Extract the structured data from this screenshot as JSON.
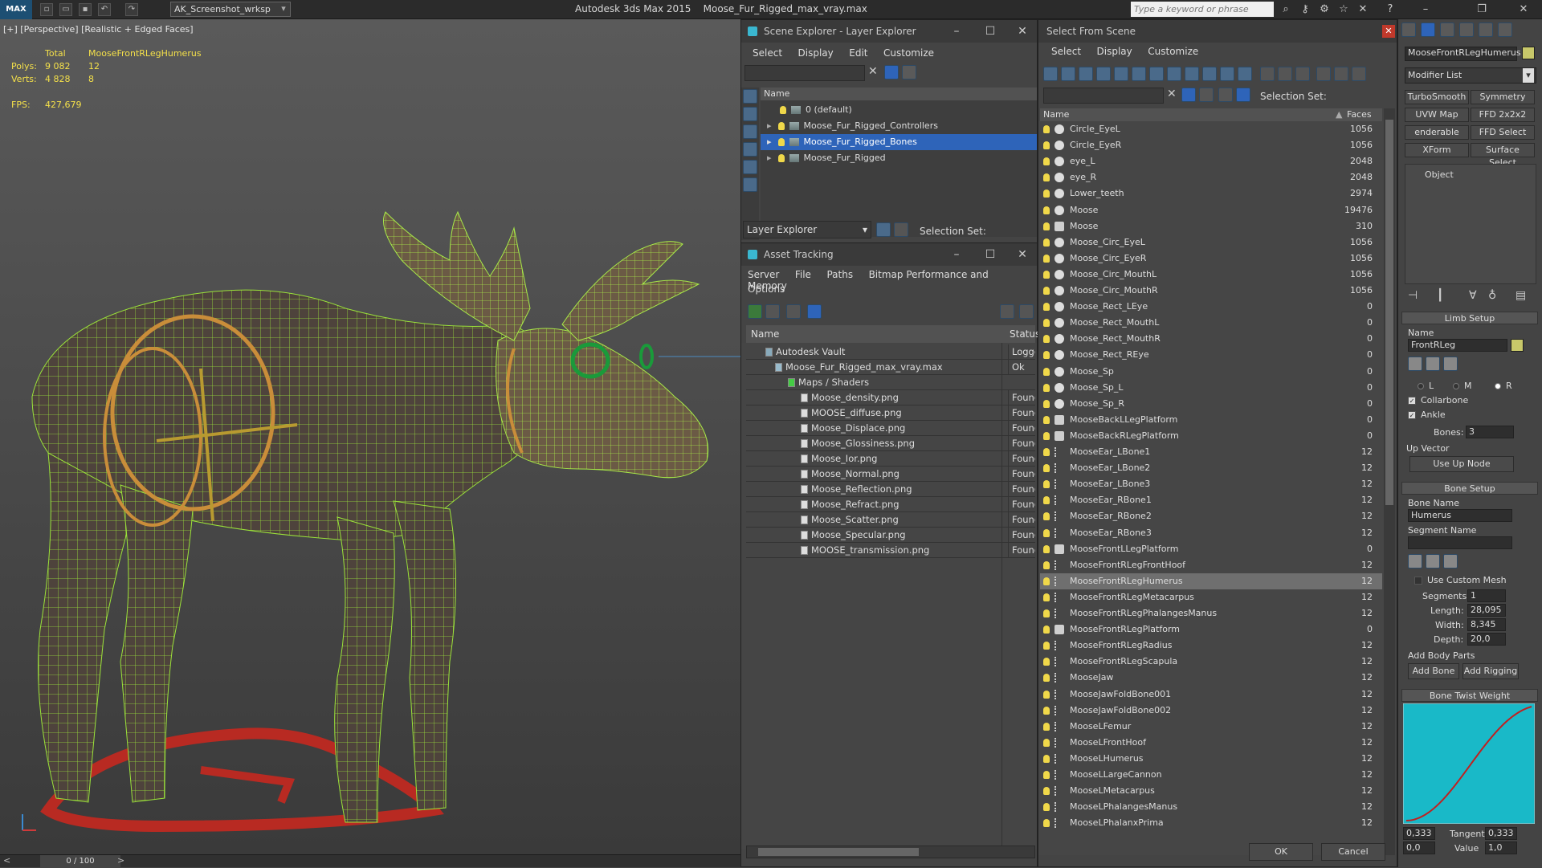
{
  "app": {
    "logo": "MAX",
    "workspace": "AK_Screenshot_wrksp",
    "title": "Autodesk 3ds Max  2015",
    "filename": "Moose_Fur_Rigged_max_vray.max",
    "search_placeholder": "Type a keyword or phrase"
  },
  "viewport": {
    "label": "[+] [Perspective] [Realistic + Edged Faces]",
    "stats": {
      "total_label": "Total",
      "object_name": "MooseFrontRLegHumerus",
      "polys_label": "Polys:",
      "polys_total": "9 082",
      "polys_obj": "12",
      "verts_label": "Verts:",
      "verts_total": "4 828",
      "verts_obj": "8",
      "fps_label": "FPS:",
      "fps_value": "427,679"
    }
  },
  "timeline": {
    "frame": "0 / 100",
    "prev": "<",
    "next": ">"
  },
  "scene_explorer": {
    "title": "Scene Explorer - Layer Explorer",
    "menus": [
      "Select",
      "Display",
      "Edit",
      "Customize"
    ],
    "column": "Name",
    "layers": [
      {
        "name": "0 (default)",
        "selected": false,
        "expandable": false
      },
      {
        "name": "Moose_Fur_Rigged_Controllers",
        "selected": false,
        "expandable": true
      },
      {
        "name": "Moose_Fur_Rigged_Bones",
        "selected": true,
        "expandable": true
      },
      {
        "name": "Moose_Fur_Rigged",
        "selected": false,
        "expandable": true
      }
    ],
    "footer_dropdown": "Layer Explorer",
    "selection_set_label": "Selection Set:"
  },
  "asset_tracking": {
    "title": "Asset Tracking",
    "menus": [
      "Server",
      "File",
      "Paths",
      "Bitmap Performance and Memory"
    ],
    "menus2": [
      "Options"
    ],
    "col_name": "Name",
    "col_status": "Status",
    "rows": [
      {
        "name": "Autodesk Vault",
        "status": "Logged",
        "indent": 1
      },
      {
        "name": "Moose_Fur_Rigged_max_vray.max",
        "status": "Ok",
        "indent": 2
      },
      {
        "name": "Maps / Shaders",
        "status": "",
        "indent": 3
      },
      {
        "name": "Moose_density.png",
        "status": "Found",
        "indent": 4
      },
      {
        "name": "MOOSE_diffuse.png",
        "status": "Found",
        "indent": 4
      },
      {
        "name": "Moose_Displace.png",
        "status": "Found",
        "indent": 4
      },
      {
        "name": "Moose_Glossiness.png",
        "status": "Found",
        "indent": 4
      },
      {
        "name": "Moose_Ior.png",
        "status": "Found",
        "indent": 4
      },
      {
        "name": "Moose_Normal.png",
        "status": "Found",
        "indent": 4
      },
      {
        "name": "Moose_Reflection.png",
        "status": "Found",
        "indent": 4
      },
      {
        "name": "Moose_Refract.png",
        "status": "Found",
        "indent": 4
      },
      {
        "name": "Moose_Scatter.png",
        "status": "Found",
        "indent": 4
      },
      {
        "name": "Moose_Specular.png",
        "status": "Found",
        "indent": 4
      },
      {
        "name": "MOOSE_transmission.png",
        "status": "Found",
        "indent": 4
      }
    ]
  },
  "select_from_scene": {
    "title": "Select From Scene",
    "menus": [
      "Select",
      "Display",
      "Customize"
    ],
    "selection_set_label": "Selection Set:",
    "col_name": "Name",
    "col_faces": "Faces",
    "ok": "OK",
    "cancel": "Cancel",
    "rows": [
      {
        "name": "Circle_EyeL",
        "faces": "1056",
        "kind": "sphere"
      },
      {
        "name": "Circle_EyeR",
        "faces": "1056",
        "kind": "sphere"
      },
      {
        "name": "eye_L",
        "faces": "2048",
        "kind": "sphere"
      },
      {
        "name": "eye_R",
        "faces": "2048",
        "kind": "sphere"
      },
      {
        "name": "Lower_teeth",
        "faces": "2974",
        "kind": "sphere"
      },
      {
        "name": "Moose",
        "faces": "19476",
        "kind": "sphere"
      },
      {
        "name": "Moose",
        "faces": "310",
        "kind": "box"
      },
      {
        "name": "Moose_Circ_EyeL",
        "faces": "1056",
        "kind": "sphere"
      },
      {
        "name": "Moose_Circ_EyeR",
        "faces": "1056",
        "kind": "sphere"
      },
      {
        "name": "Moose_Circ_MouthL",
        "faces": "1056",
        "kind": "sphere"
      },
      {
        "name": "Moose_Circ_MouthR",
        "faces": "1056",
        "kind": "sphere"
      },
      {
        "name": "Moose_Rect_LEye",
        "faces": "0",
        "kind": "sphere"
      },
      {
        "name": "Moose_Rect_MouthL",
        "faces": "0",
        "kind": "sphere"
      },
      {
        "name": "Moose_Rect_MouthR",
        "faces": "0",
        "kind": "sphere"
      },
      {
        "name": "Moose_Rect_REye",
        "faces": "0",
        "kind": "sphere"
      },
      {
        "name": "Moose_Sp",
        "faces": "0",
        "kind": "sphere"
      },
      {
        "name": "Moose_Sp_L",
        "faces": "0",
        "kind": "sphere"
      },
      {
        "name": "Moose_Sp_R",
        "faces": "0",
        "kind": "sphere"
      },
      {
        "name": "MooseBackLLegPlatform",
        "faces": "0",
        "kind": "box"
      },
      {
        "name": "MooseBackRLegPlatform",
        "faces": "0",
        "kind": "box"
      },
      {
        "name": "MooseEar_LBone1",
        "faces": "12",
        "kind": "bone"
      },
      {
        "name": "MooseEar_LBone2",
        "faces": "12",
        "kind": "bone"
      },
      {
        "name": "MooseEar_LBone3",
        "faces": "12",
        "kind": "bone"
      },
      {
        "name": "MooseEar_RBone1",
        "faces": "12",
        "kind": "bone"
      },
      {
        "name": "MooseEar_RBone2",
        "faces": "12",
        "kind": "bone"
      },
      {
        "name": "MooseEar_RBone3",
        "faces": "12",
        "kind": "bone"
      },
      {
        "name": "MooseFrontLLegPlatform",
        "faces": "0",
        "kind": "box"
      },
      {
        "name": "MooseFrontRLegFrontHoof",
        "faces": "12",
        "kind": "bone"
      },
      {
        "name": "MooseFrontRLegHumerus",
        "faces": "12",
        "kind": "bone",
        "selected": true
      },
      {
        "name": "MooseFrontRLegMetacarpus",
        "faces": "12",
        "kind": "bone"
      },
      {
        "name": "MooseFrontRLegPhalangesManus",
        "faces": "12",
        "kind": "bone"
      },
      {
        "name": "MooseFrontRLegPlatform",
        "faces": "0",
        "kind": "box"
      },
      {
        "name": "MooseFrontRLegRadius",
        "faces": "12",
        "kind": "bone"
      },
      {
        "name": "MooseFrontRLegScapula",
        "faces": "12",
        "kind": "bone"
      },
      {
        "name": "MooseJaw",
        "faces": "12",
        "kind": "bone"
      },
      {
        "name": "MooseJawFoldBone001",
        "faces": "12",
        "kind": "bone"
      },
      {
        "name": "MooseJawFoldBone002",
        "faces": "12",
        "kind": "bone"
      },
      {
        "name": "MooseLFemur",
        "faces": "12",
        "kind": "bone"
      },
      {
        "name": "MooseLFrontHoof",
        "faces": "12",
        "kind": "bone"
      },
      {
        "name": "MooseLHumerus",
        "faces": "12",
        "kind": "bone"
      },
      {
        "name": "MooseLLargeCannon",
        "faces": "12",
        "kind": "bone"
      },
      {
        "name": "MooseLMetacarpus",
        "faces": "12",
        "kind": "bone"
      },
      {
        "name": "MooseLPhalangesManus",
        "faces": "12",
        "kind": "bone"
      },
      {
        "name": "MooseLPhalanxPrima",
        "faces": "12",
        "kind": "bone"
      }
    ]
  },
  "command_panel": {
    "object_name": "MooseFrontRLegHumerus",
    "modifier_list": "Modifier List",
    "modifier_buttons": [
      "TurboSmooth",
      "Symmetry",
      "UVW Map",
      "FFD 2x2x2",
      "enderable Splin",
      "FFD Select",
      "XForm",
      "Surface Select"
    ],
    "object_label": "Object",
    "limb_setup": {
      "title": "Limb Setup",
      "name_label": "Name",
      "name_value": "FrontRLeg",
      "radio_l": "L",
      "radio_m": "M",
      "radio_r": "R",
      "collarbone": "Collarbone",
      "ankle": "Ankle",
      "bones_label": "Bones:",
      "bones_value": "3",
      "up_vector": "Up Vector",
      "use_up_node": "Use Up Node"
    },
    "bone_setup": {
      "title": "Bone Setup",
      "bone_name_label": "Bone Name",
      "bone_name_value": "Humerus",
      "segment_name_label": "Segment Name",
      "segment_name_value": "",
      "use_custom_mesh": "Use Custom Mesh",
      "segments_label": "Segments:",
      "segments_value": "1",
      "length_label": "Length:",
      "length_value": "28,095",
      "width_label": "Width:",
      "width_value": "8,345",
      "depth_label": "Depth:",
      "depth_value": "20,0",
      "add_body_parts": "Add Body Parts",
      "add_bone": "Add Bone",
      "add_rigging": "Add Rigging"
    },
    "bone_twist": {
      "title": "Bone Twist Weight",
      "v1": "0,333",
      "tangent_label": "Tangent",
      "v2": "0,333",
      "v3": "0,0",
      "value_label": "Value",
      "v4": "1,0"
    }
  }
}
